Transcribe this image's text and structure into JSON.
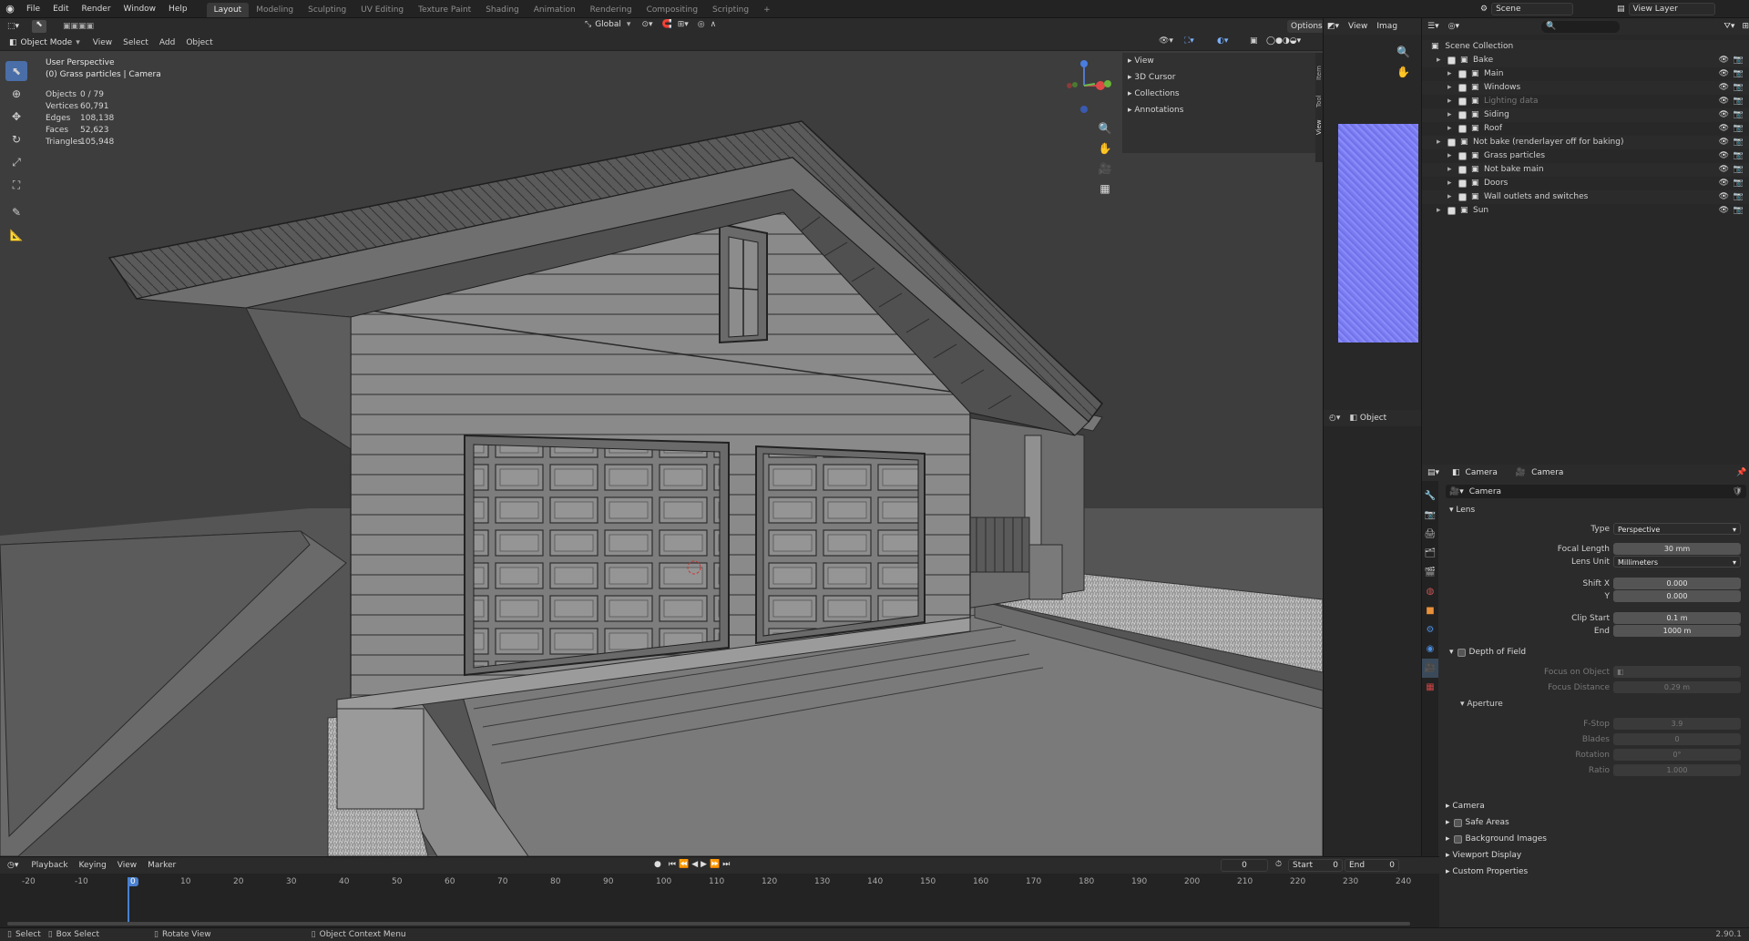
{
  "menu": [
    "File",
    "Edit",
    "Render",
    "Window",
    "Help"
  ],
  "workspaces": [
    "Layout",
    "Modeling",
    "Sculpting",
    "UV Editing",
    "Texture Paint",
    "Shading",
    "Animation",
    "Rendering",
    "Compositing",
    "Scripting"
  ],
  "add_ws": "+",
  "scene": "Scene",
  "view_layer": "View Layer",
  "toolbar": {
    "orientation": "Global",
    "options": "Options"
  },
  "viewport": {
    "mode": "Object Mode",
    "menus": [
      "View",
      "Select",
      "Add",
      "Object"
    ],
    "perspective": "User Perspective",
    "context": "(0) Grass particles | Camera",
    "stats": [
      {
        "label": "Objects",
        "value": "0 / 79"
      },
      {
        "label": "Vertices",
        "value": "60,791"
      },
      {
        "label": "Edges",
        "value": "108,138"
      },
      {
        "label": "Faces",
        "value": "52,623"
      },
      {
        "label": "Triangles",
        "value": "105,948"
      }
    ],
    "npanel": [
      "View",
      "3D Cursor",
      "Collections",
      "Annotations"
    ],
    "side_tabs": [
      "Item",
      "Tool",
      "View"
    ]
  },
  "image_editor": {
    "view": "View",
    "image": "Imag",
    "mode": "Object"
  },
  "outliner": {
    "root": "Scene Collection",
    "rows": [
      {
        "name": "Bake",
        "indent": 1,
        "dim": false
      },
      {
        "name": "Main",
        "indent": 2,
        "dim": false
      },
      {
        "name": "Windows",
        "indent": 2,
        "dim": false
      },
      {
        "name": "Lighting data",
        "indent": 2,
        "dim": true
      },
      {
        "name": "Siding",
        "indent": 2,
        "dim": false
      },
      {
        "name": "Roof",
        "indent": 2,
        "dim": false
      },
      {
        "name": "Not bake (renderlayer off for baking)",
        "indent": 1,
        "dim": false
      },
      {
        "name": "Grass particles",
        "indent": 2,
        "dim": false
      },
      {
        "name": "Not bake main",
        "indent": 2,
        "dim": false
      },
      {
        "name": "Doors",
        "indent": 2,
        "dim": false
      },
      {
        "name": "Wall outlets and switches",
        "indent": 2,
        "dim": false
      },
      {
        "name": "Sun",
        "indent": 1,
        "dim": false
      }
    ]
  },
  "properties": {
    "breadcrumb": [
      "Camera",
      "Camera"
    ],
    "datablock": "Camera",
    "lens_title": "Lens",
    "type_label": "Type",
    "type_value": "Perspective",
    "focal_label": "Focal Length",
    "focal_value": "30 mm",
    "lensunit_label": "Lens Unit",
    "lensunit_value": "Millimeters",
    "shiftx_label": "Shift X",
    "shiftx_value": "0.000",
    "y_label": "Y",
    "y_value": "0.000",
    "clipstart_label": "Clip Start",
    "clipstart_value": "0.1 m",
    "end_label": "End",
    "end_value": "1000 m",
    "dof_title": "Depth of Field",
    "focus_obj_label": "Focus on Object",
    "focus_dist_label": "Focus Distance",
    "focus_dist_value": "0.29 m",
    "aperture_title": "Aperture",
    "fstop_label": "F-Stop",
    "fstop_value": "3.9",
    "blades_label": "Blades",
    "blades_value": "0",
    "rotation_label": "Rotation",
    "rotation_value": "0°",
    "ratio_label": "Ratio",
    "ratio_value": "1.000",
    "sections": [
      "Camera",
      "Safe Areas",
      "Background Images",
      "Viewport Display",
      "Custom Properties"
    ]
  },
  "timeline": {
    "menus": [
      "Playback",
      "Keying",
      "View",
      "Marker"
    ],
    "current": "0",
    "start_label": "Start",
    "start": "0",
    "end_label": "End",
    "end": "0",
    "ticks": [
      "-20",
      "-10",
      "0",
      "10",
      "20",
      "30",
      "40",
      "50",
      "60",
      "70",
      "80",
      "90",
      "100",
      "110",
      "120",
      "130",
      "140",
      "150",
      "160",
      "170",
      "180",
      "190",
      "200",
      "210",
      "220",
      "230",
      "240"
    ]
  },
  "status": {
    "select": "Select",
    "box_select": "Box Select",
    "rotate": "Rotate View",
    "context": "Object Context Menu",
    "version": "2.90.1"
  }
}
